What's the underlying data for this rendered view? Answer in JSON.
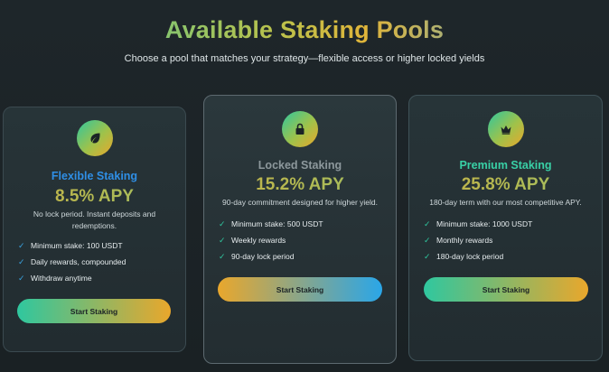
{
  "header": {
    "title": "Available Staking Pools",
    "subtitle": "Choose a pool that matches your strategy—flexible access or higher locked yields"
  },
  "pools": [
    {
      "name": "Flexible Staking",
      "name_color": "#2f8fe6",
      "apy": "8.5% APY",
      "description": "No lock period. Instant deposits and redemptions.",
      "icon": "leaf-icon",
      "features": [
        "Minimum stake: 100 USDT",
        "Daily rewards, compounded",
        "Withdraw anytime"
      ],
      "button_label": "Start Staking",
      "button_gradient": [
        "#2fc79f",
        "#e9a72c"
      ]
    },
    {
      "name": "Locked Staking",
      "name_color": "#8d989c",
      "apy": "15.2% APY",
      "description": "90-day commitment designed for higher yield.",
      "icon": "lock-icon",
      "features": [
        "Minimum stake: 500 USDT",
        "Weekly rewards",
        "90-day lock period"
      ],
      "button_label": "Start Staking",
      "button_gradient": [
        "#e9a72c",
        "#2aa6e8"
      ]
    },
    {
      "name": "Premium Staking",
      "name_color": "#39d0a6",
      "apy": "25.8% APY",
      "description": "180-day term with our most competitive APY.",
      "icon": "crown-icon",
      "features": [
        "Minimum stake: 1000 USDT",
        "Monthly rewards",
        "180-day lock period"
      ],
      "button_label": "Start Staking",
      "button_gradient": [
        "#2fc79f",
        "#e9a72c"
      ]
    }
  ]
}
